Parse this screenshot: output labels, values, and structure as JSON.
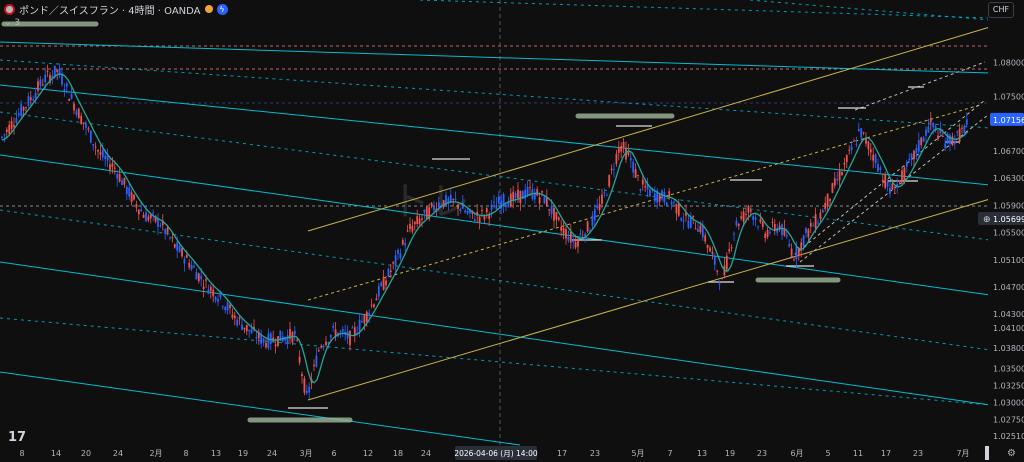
{
  "header": {
    "symbol_title": "ポンド／スイスフラン · 4時間 · OANDA",
    "indicator_label": "3",
    "currency_button": "CHF"
  },
  "icons": [
    "gb-flag-icon",
    "orange-dot-icon",
    "blue-flash-icon",
    "tradingview-logo-icon",
    "gear-icon"
  ],
  "colors": {
    "background": "#0f0f0f",
    "up_candle": "#2962ff",
    "down_candle": "#ef5350",
    "moving_average": "#26a69a",
    "channel_lines": "#00bcd4",
    "trend_lines": "#c9b24a",
    "last_price_badge": "#2962ff"
  },
  "chart_data": {
    "type": "candlestick",
    "title": "ポンド／スイスフラン · 4時間 · OANDA",
    "xlabel": "",
    "ylabel": "",
    "ylim": [
      1.0251,
      1.083
    ],
    "y_ticks": [
      "1.08000",
      "1.07500",
      "1.07156",
      "1.06700",
      "1.06300",
      "1.05900",
      "1.05699",
      "1.05500",
      "1.05100",
      "1.04700",
      "1.04300",
      "1.04100",
      "1.03800",
      "1.03500",
      "1.03250",
      "1.03000",
      "1.02750",
      "1.02510"
    ],
    "x_ticks": [
      "8",
      "14",
      "20",
      "24",
      "2月",
      "8",
      "13",
      "19",
      "24",
      "3月",
      "6",
      "12",
      "18",
      "24",
      "2026-04-06 (月)  14:00",
      "17",
      "23",
      "5月",
      "7",
      "13",
      "19",
      "23",
      "6月",
      "5",
      "11",
      "17",
      "23",
      "7月"
    ],
    "crosshair_label": "2026-04-06 (月)  14:00",
    "last_price": "1.07156",
    "crosshair_price": "1.05699",
    "path_x": [
      0,
      14,
      30,
      44,
      58,
      72,
      86,
      100,
      115,
      130,
      145,
      160,
      175,
      190,
      205,
      220,
      235,
      250,
      265,
      280,
      295,
      307,
      320,
      335,
      350,
      365,
      380,
      395,
      410,
      425,
      440,
      455,
      470,
      485,
      500,
      515,
      530,
      545,
      560,
      575,
      590,
      605,
      620,
      630,
      640,
      655,
      670,
      685,
      700,
      715,
      722,
      735,
      750,
      765,
      780,
      795,
      805,
      820,
      835,
      850,
      860,
      875,
      890,
      900,
      915,
      930,
      945,
      958,
      970
    ],
    "path_y": [
      1.0685,
      1.0715,
      1.0745,
      1.0775,
      1.0788,
      1.0745,
      1.0705,
      1.0665,
      1.0645,
      1.0605,
      1.0575,
      1.0565,
      1.053,
      1.0505,
      1.0475,
      1.0455,
      1.0425,
      1.0405,
      1.039,
      1.0395,
      1.04,
      1.0305,
      1.0385,
      1.0405,
      1.0395,
      1.0425,
      1.0465,
      1.0505,
      1.0555,
      1.0575,
      1.0595,
      1.0595,
      1.0575,
      1.0575,
      1.0595,
      1.06,
      1.061,
      1.06,
      1.056,
      1.0535,
      1.056,
      1.0605,
      1.068,
      1.066,
      1.062,
      1.0605,
      1.06,
      1.057,
      1.056,
      1.0505,
      1.0475,
      1.056,
      1.0585,
      1.055,
      1.056,
      1.0515,
      1.0545,
      1.0575,
      1.062,
      1.0665,
      1.07,
      1.066,
      1.061,
      1.0625,
      1.0665,
      1.071,
      1.0685,
      1.069,
      1.0715
    ]
  }
}
